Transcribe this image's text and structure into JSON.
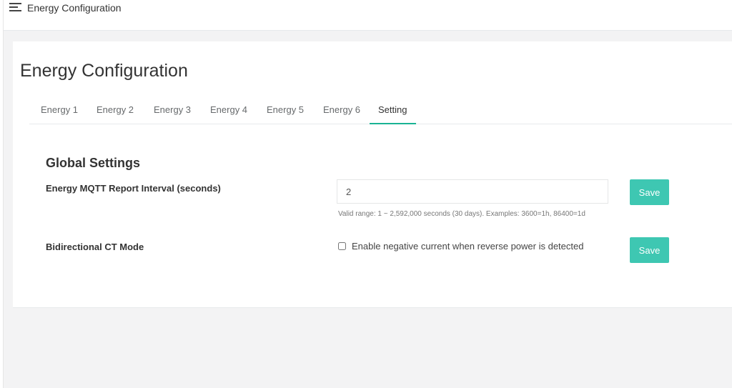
{
  "topbar": {
    "menu_icon": "hamburger-icon",
    "title": "Energy Configuration"
  },
  "page": {
    "title": "Energy Configuration"
  },
  "tabs": [
    {
      "label": "Energy 1",
      "active": false
    },
    {
      "label": "Energy 2",
      "active": false
    },
    {
      "label": "Energy 3",
      "active": false
    },
    {
      "label": "Energy 4",
      "active": false
    },
    {
      "label": "Energy 5",
      "active": false
    },
    {
      "label": "Energy 6",
      "active": false
    },
    {
      "label": "Setting",
      "active": true
    }
  ],
  "settings": {
    "section_title": "Global Settings",
    "report_interval": {
      "label": "Energy MQTT Report Interval (seconds)",
      "value": "2",
      "help": "Valid range: 1 ~ 2,592,000 seconds (30 days). Examples: 3600=1h, 86400=1d",
      "save_label": "Save"
    },
    "bidirectional": {
      "label": "Bidirectional CT Mode",
      "checkbox_label": "Enable negative current when reverse power is detected",
      "checked": false,
      "save_label": "Save"
    }
  },
  "colors": {
    "accent": "#1ab394",
    "button": "#3ec7b2",
    "background": "#f3f3f4"
  }
}
